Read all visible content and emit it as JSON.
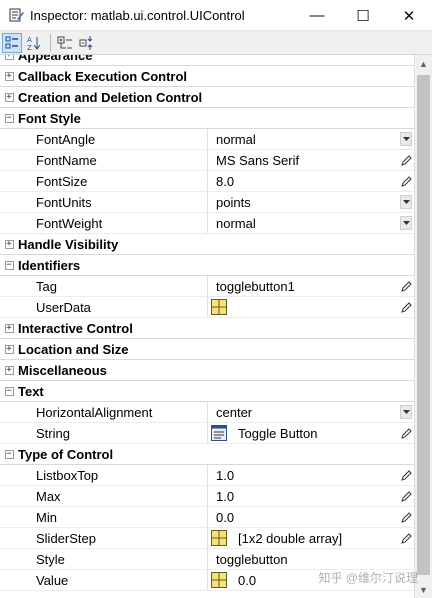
{
  "window": {
    "title": "Inspector:  matlab.ui.control.UIControl",
    "minimize_glyph": "—",
    "maximize_glyph": "☐",
    "close_glyph": "✕"
  },
  "toolbar": {
    "buttons": [
      {
        "name": "categorized-view-icon",
        "active": true
      },
      {
        "name": "alphabetical-sort-icon",
        "active": false
      },
      {
        "name": "expand-all-icon",
        "active": false
      },
      {
        "name": "collapse-all-icon",
        "active": false
      }
    ]
  },
  "categories": {
    "appearance": "Appearance",
    "callback": "Callback Execution Control",
    "creation": "Creation and Deletion Control",
    "font_style": "Font Style",
    "handle": "Handle Visibility",
    "identifiers": "Identifiers",
    "interactive": "Interactive Control",
    "location": "Location and Size",
    "misc": "Miscellaneous",
    "text": "Text",
    "type": "Type of Control"
  },
  "expand_glyphs": {
    "collapsed": "+",
    "expanded": "−"
  },
  "properties": {
    "font_angle": {
      "name": "FontAngle",
      "value": "normal"
    },
    "font_name": {
      "name": "FontName",
      "value": "MS Sans Serif"
    },
    "font_size": {
      "name": "FontSize",
      "value": "8.0"
    },
    "font_units": {
      "name": "FontUnits",
      "value": "points"
    },
    "font_weight": {
      "name": "FontWeight",
      "value": "normal"
    },
    "tag": {
      "name": "Tag",
      "value": "togglebutton1"
    },
    "user_data": {
      "name": "UserData",
      "value": ""
    },
    "horiz_align": {
      "name": "HorizontalAlignment",
      "value": "center"
    },
    "string": {
      "name": "String",
      "value": "Toggle Button"
    },
    "listbox_top": {
      "name": "ListboxTop",
      "value": "1.0"
    },
    "max": {
      "name": "Max",
      "value": "1.0"
    },
    "min": {
      "name": "Min",
      "value": "0.0"
    },
    "slider_step": {
      "name": "SliderStep",
      "value": "[1x2  double array]"
    },
    "style": {
      "name": "Style",
      "value": "togglebutton"
    },
    "value": {
      "name": "Value",
      "value": "0.0"
    }
  },
  "watermark": "知乎 @维尔汀说理",
  "colors": {
    "toolbar_bg": "#f0f0f0",
    "active_button": "#cce4f7",
    "grid_line": "#ececec",
    "scroll_thumb": "#c2c2c2"
  }
}
